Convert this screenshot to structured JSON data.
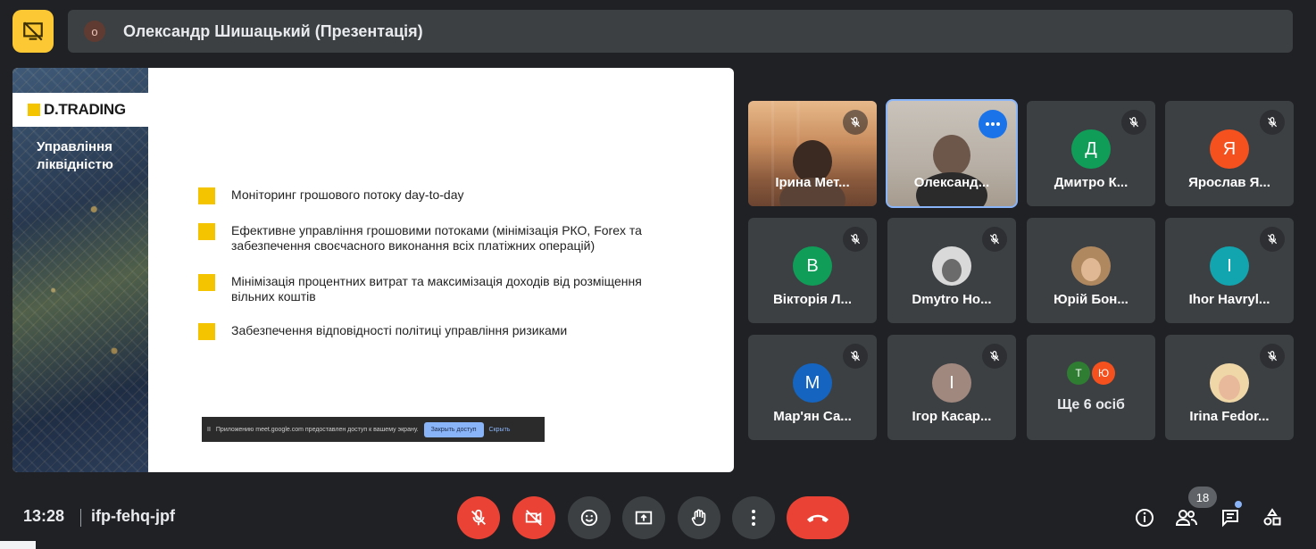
{
  "header": {
    "badge": "o",
    "title": "Олександр Шишацький (Презентація)",
    "presenting_icon": "present-screen-icon"
  },
  "slide": {
    "logo": "D.TRADING",
    "heading": "Управління ліквідністю",
    "bullets": [
      "Моніторинг грошового потоку day-to-day",
      "Ефективне управління грошовими потоками (мінімізація РКО, Forex та забезпечення своєчасного виконання всіх платіжних операцій)",
      "Мінімізація процентних витрат та максимізація доходів від розміщення вільних коштів",
      "Забезпечення відповідності політиці управління ризиками"
    ],
    "share_bar": {
      "pause": "II",
      "text": "Приложению meet.google.com предоставлен доступ к вашему экрану.",
      "stop_button": "Закрыть доступ",
      "hide_link": "Скрыть"
    }
  },
  "participants": [
    {
      "name": "Ірина Мет...",
      "type": "video1",
      "muted": true
    },
    {
      "name": "Олександ...",
      "type": "video2",
      "active": true
    },
    {
      "name": "Дмитро К...",
      "initial": "Д",
      "color": "#0f9d58",
      "muted": true
    },
    {
      "name": "Ярослав Я...",
      "initial": "Я",
      "color": "#f4511e",
      "muted": true
    },
    {
      "name": "Вікторія Л...",
      "initial": "В",
      "color": "#0f9d58",
      "muted": true
    },
    {
      "name": "Dmytro Ho...",
      "type": "photo",
      "color": "#d9d9d9",
      "muted": true
    },
    {
      "name": "Юрій Бон...",
      "type": "photo",
      "color": "#b08860",
      "muted": false
    },
    {
      "name": "Ihor Havryl...",
      "initial": "I",
      "color": "#12a4af",
      "muted": true
    },
    {
      "name": "Мар'ян Са...",
      "initial": "М",
      "color": "#1565c0",
      "muted": true
    },
    {
      "name": "Ігор Касар...",
      "initial": "І",
      "color": "#a1887f",
      "muted": true
    },
    {
      "name": "Ще 6 осіб",
      "type": "others",
      "others": [
        {
          "initial": "Т",
          "color": "#2e7d32"
        },
        {
          "initial": "Ю",
          "color": "#f4511e"
        }
      ]
    },
    {
      "name": "Irina Fedor...",
      "type": "photo",
      "color": "#f0d7a8",
      "muted": true
    }
  ],
  "footer": {
    "time": "13:28",
    "meeting_code": "ifp-fehq-jpf",
    "participant_count": "18"
  },
  "colors": {
    "background": "#202124",
    "tile": "#3c4043",
    "red": "#ea4335",
    "accent_blue": "#8ab4f8",
    "yellow": "#f5c400"
  }
}
